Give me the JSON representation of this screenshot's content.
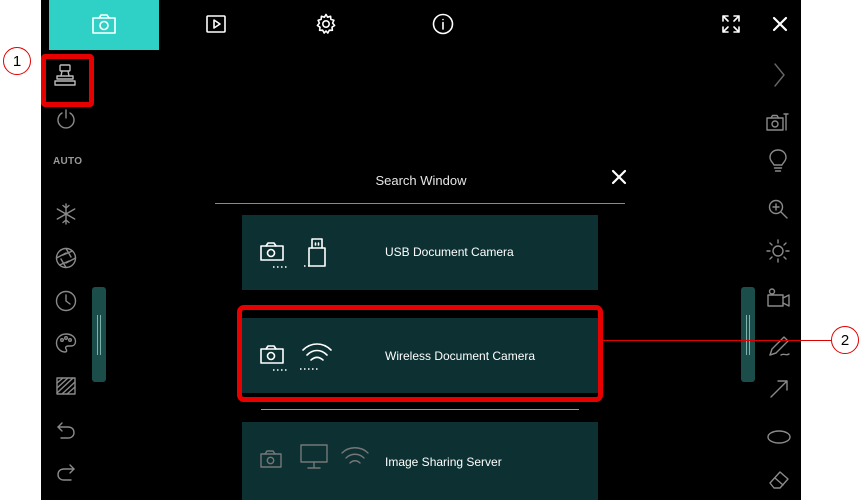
{
  "dialog": {
    "title": "Search Window",
    "options": [
      {
        "label": "USB Document Camera"
      },
      {
        "label": "Wireless Document Camera"
      },
      {
        "label": "Image Sharing Server"
      }
    ]
  },
  "left_toolbar": {
    "auto_label": "AUTO"
  },
  "callouts": {
    "one": "1",
    "two": "2"
  },
  "icons": {
    "top": [
      "camera-icon",
      "play-icon",
      "gear-icon",
      "info-icon",
      "fullscreen-icon",
      "close-icon"
    ],
    "left": [
      "document-camera-icon",
      "power-icon",
      "auto-focus",
      "freeze-icon",
      "aperture-icon",
      "timer-icon",
      "palette-icon",
      "mask-icon",
      "undo-icon",
      "redo-icon"
    ],
    "right": [
      "chevron-right-icon",
      "camera-settings-icon",
      "lamp-icon",
      "zoom-icon",
      "brightness-icon",
      "video-icon",
      "pen-icon",
      "arrow-icon",
      "ellipse-icon",
      "eraser-icon"
    ]
  },
  "colors": {
    "accent": "#2fd0c5",
    "card": "#0d3132",
    "annotation": "#e60000",
    "background": "#000000"
  }
}
